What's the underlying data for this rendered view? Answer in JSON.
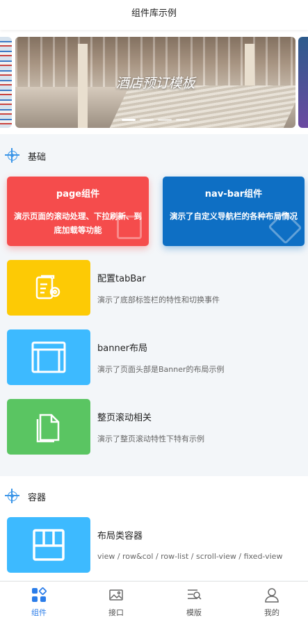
{
  "nav": {
    "title": "组件库示例"
  },
  "banner": {
    "title": "酒店预订模板",
    "dot_count": 4,
    "active_index": 0
  },
  "basic": {
    "heading": "基础",
    "cards": [
      {
        "title": "page组件",
        "desc": "演示页面的滚动处理、下拉刷新、到底加载等功能",
        "color": "#f54c4c"
      },
      {
        "title": "nav-bar组件",
        "desc": "演示了自定义导航栏的各种布局情况",
        "color": "#0e6fc4"
      }
    ],
    "items": [
      {
        "title": "配置tabBar",
        "desc": "演示了底部标签栏的特性和切换事件",
        "color": "#fdca05",
        "icon": "tabbar-config-icon"
      },
      {
        "title": "banner布局",
        "desc": "演示了页面头部是Banner的布局示例",
        "color": "#3dbaff",
        "icon": "banner-layout-icon"
      },
      {
        "title": "整页滚动相关",
        "desc": "演示了整页滚动特性下特有示例",
        "color": "#5ac562",
        "icon": "document-icon"
      }
    ]
  },
  "container": {
    "heading": "容器",
    "items": [
      {
        "title": "布局类容器",
        "desc": "view / row&col / row-list / scroll-view / fixed-view",
        "color": "#3dbaff",
        "icon": "grid-layout-icon"
      }
    ]
  },
  "tabbar": {
    "active": 0,
    "tabs": [
      {
        "label": "组件",
        "icon": "components-icon"
      },
      {
        "label": "接口",
        "icon": "image-icon"
      },
      {
        "label": "模版",
        "icon": "template-icon"
      },
      {
        "label": "我的",
        "icon": "user-icon"
      }
    ]
  },
  "colors": {
    "accent": "#2b7de9",
    "section_icon": "#3a95e8"
  }
}
